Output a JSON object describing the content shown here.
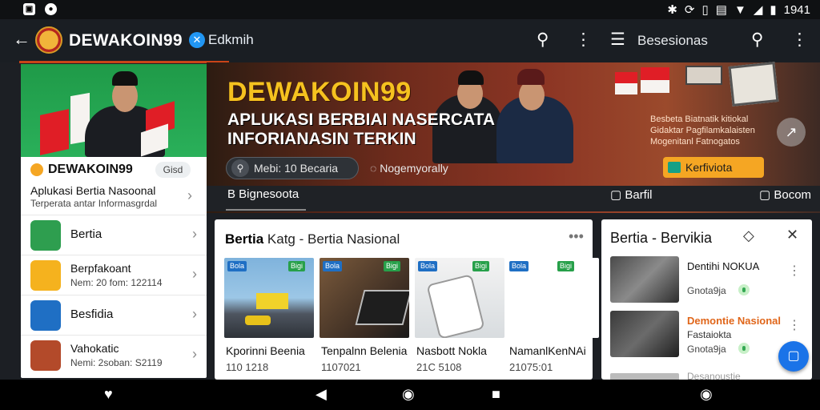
{
  "status_bar": {
    "left_icons": [
      "gallery-icon",
      "notification-icon"
    ],
    "time": "1941"
  },
  "app_bar": {
    "brand": "DEWAKOIN99",
    "edit_label": "Edkmih",
    "right_title": "Besesionas"
  },
  "hero": {
    "title": "DEWAKOIN99",
    "subtitle_line1": "APLUKASI BERBIAI NASERCATA",
    "subtitle_line2": "INFORIANASIN TERKIN",
    "caption_line1": "Besbeta Biatnatik kitiokal",
    "caption_line2": "Gidaktar Pagfilamkalaisten",
    "caption_line3": "Mogenitanl Fatnogatos",
    "cta_label": "Kerfiviota",
    "search_text": "Mebi: 10 Becaria",
    "search_text2": "Nogemyorally"
  },
  "categories": [
    "B Bignesoota",
    "Barfil",
    "Bocom"
  ],
  "left_card": {
    "brand": "DEWAKOIN99",
    "chip": "Gisd",
    "title": "Aplukasi Bertia Nasoonal",
    "subtitle": "Terperata antar Informasgrdal",
    "items": [
      {
        "label": "Bertia",
        "sub": "",
        "icon_color": "#2e9e4f"
      },
      {
        "label": "Berpfakoant",
        "sub": "Nem: 20 fom: 122114",
        "icon_color": "#f5b21e"
      },
      {
        "label": "Besfidia",
        "sub": "",
        "icon_color": "#1f6fc4"
      },
      {
        "label": "Vahokatic",
        "sub": "Nemi: 2soban: S2119",
        "icon_color": "#b34a2a"
      }
    ]
  },
  "news_panel": {
    "title_bold": "Bertia",
    "title_rest": " Katg - Bertia Nasional",
    "cards": [
      {
        "title": "Kporinni Beenia",
        "meta": "110 1218",
        "tags": [
          "Bola",
          "Bigi"
        ]
      },
      {
        "title": "Tenpalnn Belenia",
        "meta": "1107021",
        "tags": [
          "Bola",
          "Bigi"
        ]
      },
      {
        "title": "Nasbott Nokla",
        "meta": "21C 5108",
        "tags": [
          "Bola",
          "Bigi"
        ]
      },
      {
        "title": "NamanlKenNAi",
        "meta": "21075:01",
        "tags": [
          "Bola",
          "Bigi"
        ]
      }
    ]
  },
  "right_panel": {
    "title": "Bertia - Bervikia",
    "items": [
      {
        "title": "Dentihi NOKUA",
        "sub": "",
        "meta": "Gnota9ja",
        "orange": false
      },
      {
        "title": "Demontie Nasional",
        "sub": "Fastaiokta",
        "meta": "Gnota9ja",
        "orange": true
      },
      {
        "title": "Desanoustie",
        "sub": "",
        "meta": "",
        "orange": false
      }
    ]
  },
  "colors": {
    "accent": "#c94418",
    "cta": "#f5a623",
    "brand_gold": "#f5c21f",
    "fab": "#1a73e8"
  }
}
